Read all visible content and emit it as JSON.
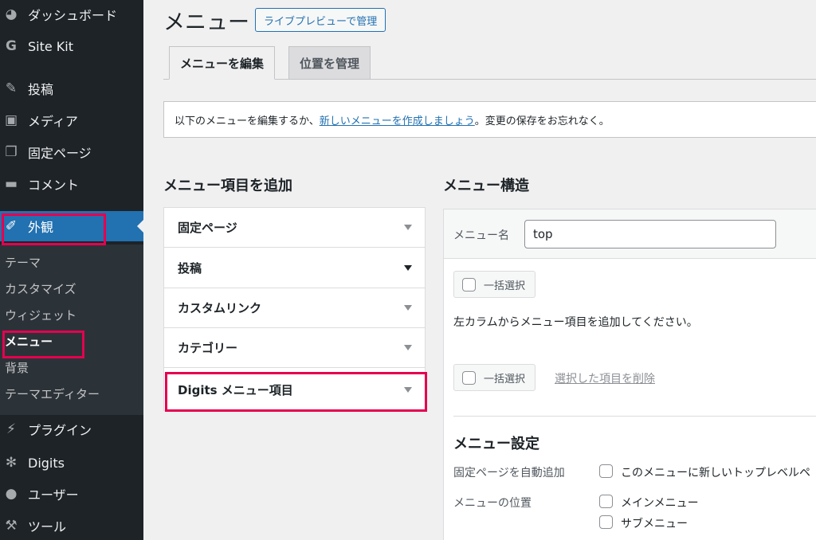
{
  "sidebar": {
    "items": [
      {
        "label": "ダッシュボード",
        "icon": "dashboard-icon"
      },
      {
        "label": "Site Kit",
        "icon": "google-g-icon"
      },
      {
        "label": "投稿",
        "icon": "pin-icon"
      },
      {
        "label": "メディア",
        "icon": "media-icon"
      },
      {
        "label": "固定ページ",
        "icon": "pages-icon"
      },
      {
        "label": "コメント",
        "icon": "comment-icon"
      },
      {
        "label": "外観",
        "icon": "paintbrush-icon"
      },
      {
        "label": "プラグイン",
        "icon": "plugin-icon"
      },
      {
        "label": "Digits",
        "icon": "digits-icon"
      },
      {
        "label": "ユーザー",
        "icon": "user-icon"
      },
      {
        "label": "ツール",
        "icon": "wrench-icon"
      }
    ],
    "submenu": [
      "テーマ",
      "カスタマイズ",
      "ウィジェット",
      "メニュー",
      "背景",
      "テーマエディター"
    ]
  },
  "header": {
    "title": "メニュー",
    "live_preview_label": "ライブプレビューで管理"
  },
  "tabs": [
    "メニューを編集",
    "位置を管理"
  ],
  "notice": {
    "before": "以下のメニューを編集するか、",
    "link": "新しいメニューを作成しましょう",
    "after": "。変更の保存をお忘れなく。"
  },
  "add_items": {
    "heading": "メニュー項目を追加",
    "sections": [
      "固定ページ",
      "投稿",
      "カスタムリンク",
      "カテゴリー",
      "Digits メニュー項目"
    ]
  },
  "structure": {
    "heading": "メニュー構造",
    "menu_name_label": "メニュー名",
    "menu_name_value": "top",
    "bulk_select_label": "一括選択",
    "hint": "左カラムからメニュー項目を追加してください。",
    "delete_selected": "選択した項目を削除"
  },
  "settings": {
    "heading": "メニュー設定",
    "auto_add_label": "固定ページを自動追加",
    "auto_add_option": "このメニューに新しいトップレベルペ",
    "location_label": "メニューの位置",
    "locations": [
      "メインメニュー",
      "サブメニュー"
    ]
  },
  "colors": {
    "sidebar_bg": "#1d2327",
    "accent": "#2271b1",
    "highlight": "#e5004f"
  }
}
